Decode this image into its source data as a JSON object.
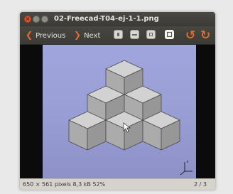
{
  "window": {
    "title": "02-Freecad-T04-ej-1-1.png",
    "controls": [
      "close",
      "minimize",
      "maximize"
    ]
  },
  "toolbar": {
    "previous_label": "Previous",
    "next_label": "Next",
    "zoom_buttons": [
      "zoom-in",
      "zoom-out",
      "zoom-normal",
      "zoom-fit"
    ],
    "rotate_buttons": [
      "rotate-counterclockwise",
      "rotate-clockwise"
    ]
  },
  "image": {
    "background": "#9a9fd6",
    "cube_colors": {
      "top": "#d2d2d2",
      "left": "#ababab",
      "right": "#979797"
    }
  },
  "status": {
    "info": "650 × 561 pixels  8,3 kB  52%",
    "page": "2 / 3"
  },
  "colors": {
    "accent": "#e8672c",
    "titlebar": "#3c3b37"
  }
}
